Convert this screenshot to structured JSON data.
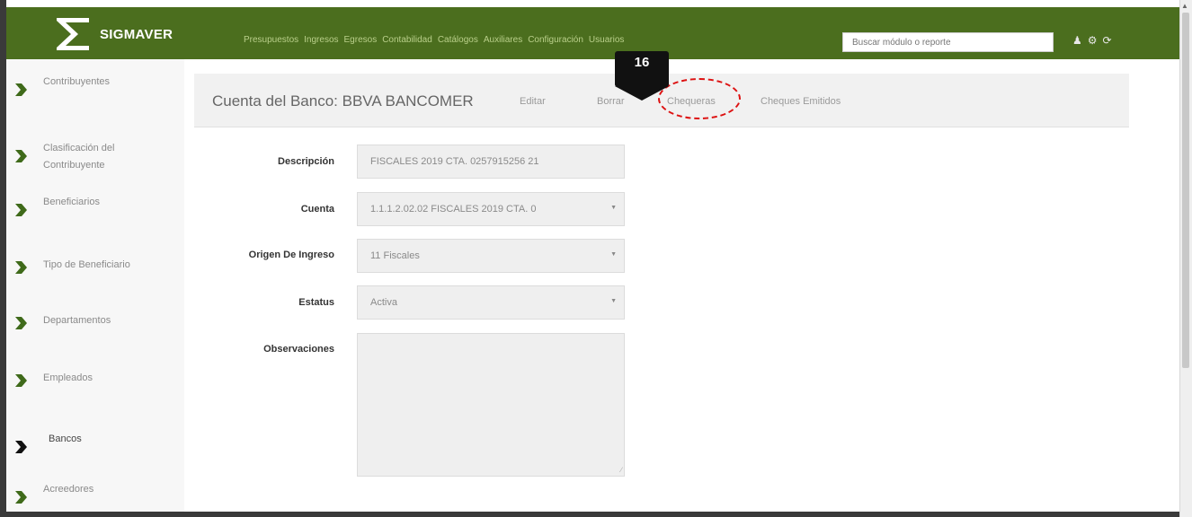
{
  "header": {
    "brand": "SIGMAVER",
    "nav": [
      "Presupuestos",
      "Ingresos",
      "Egresos",
      "Contabilidad",
      "Catálogos",
      "Auxiliares",
      "Configuración",
      "Usuarios"
    ],
    "search_placeholder": "Buscar módulo o reporte",
    "bg_color": "#4b6e1e"
  },
  "callout": {
    "number": "16"
  },
  "sidebar": {
    "items": [
      {
        "label": "Contribuyentes"
      },
      {
        "label_line1": "Clasificación del",
        "label_line2": "Contribuyente"
      },
      {
        "label": "Beneficiarios"
      },
      {
        "label": "Tipo de Beneficiario"
      },
      {
        "label": "Departamentos"
      },
      {
        "label": "Empleados"
      },
      {
        "label": "Bancos"
      },
      {
        "label": "Acreedores"
      }
    ]
  },
  "content": {
    "title": "Cuenta del Banco: BBVA BANCOMER",
    "actions": [
      "Editar",
      "Borrar",
      "Chequeras",
      "Cheques Emitidos"
    ]
  },
  "form": {
    "descripcion": {
      "label": "Descripción",
      "value": "FISCALES 2019 CTA. 0257915256 21"
    },
    "cuenta": {
      "label": "Cuenta",
      "value": "1.1.1.2.02.02 FISCALES 2019 CTA. 0"
    },
    "origen": {
      "label": "Origen De Ingreso",
      "value": "11 Fiscales"
    },
    "estatus": {
      "label": "Estatus",
      "value": "Activa"
    },
    "observaciones": {
      "label": "Observaciones",
      "value": ""
    }
  }
}
